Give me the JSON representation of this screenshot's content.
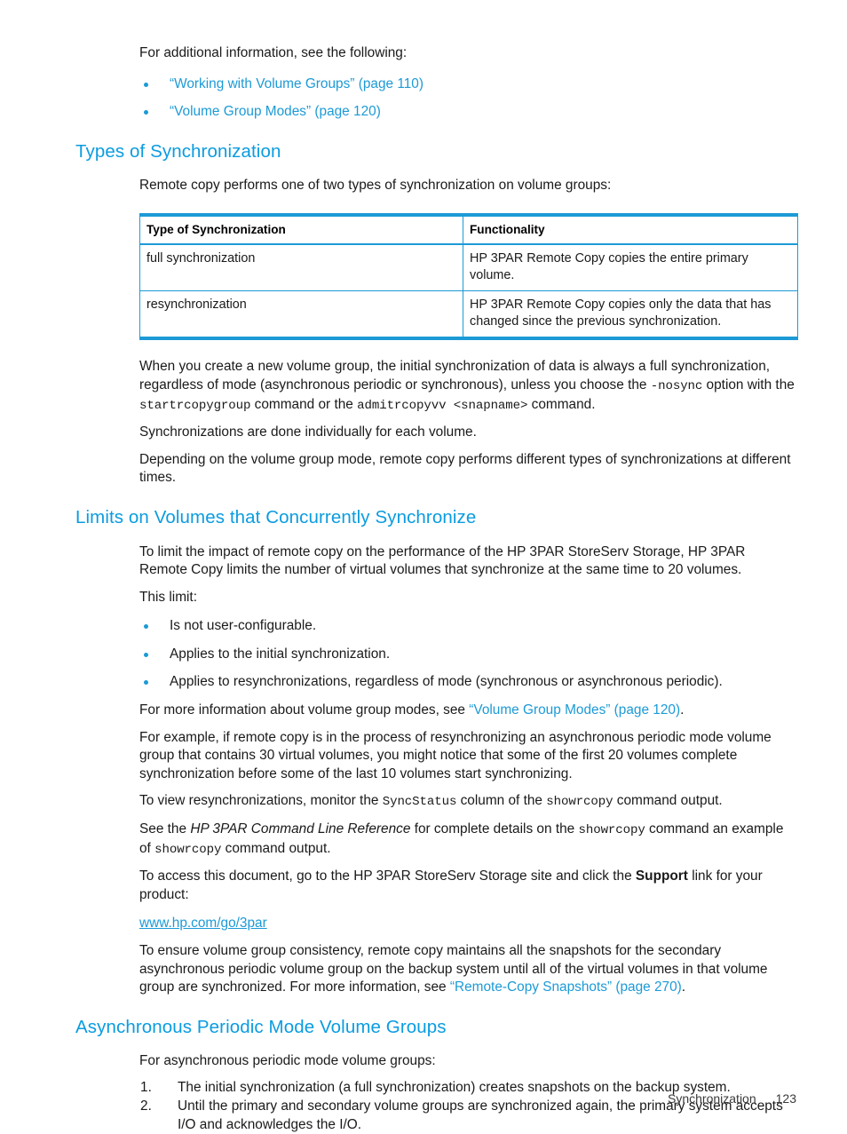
{
  "page": {
    "footer_section": "Synchronization",
    "footer_page_number": "123",
    "accent_color": "#1c9ad6",
    "heading_color": "#0a9ce0"
  },
  "intro": {
    "lead": "For additional information, see the following:",
    "links": [
      "“Working with Volume Groups” (page 110)",
      "“Volume Group Modes” (page 120)"
    ]
  },
  "types_section": {
    "heading": "Types of Synchronization",
    "intro": "Remote copy performs one of two types of synchronization on volume groups:",
    "table": {
      "headers": [
        "Type of Synchronization",
        "Functionality"
      ],
      "rows": [
        [
          "full synchronization",
          "HP 3PAR Remote Copy copies the entire primary volume."
        ],
        [
          "resynchronization",
          "HP 3PAR Remote Copy copies only the data that has changed since the previous synchronization."
        ]
      ]
    },
    "para_nosync_1": "When you create a new volume group, the initial synchronization of data is always a full synchronization, regardless of mode (asynchronous periodic or synchronous), unless you choose the ",
    "code_nosync": "-nosync",
    "para_nosync_2": " option with the ",
    "code_startrcopygroup": "startrcopygroup",
    "para_nosync_3": " command or the ",
    "code_admitrcopyvv": "admitrcopyvv <snapname>",
    "para_nosync_4": " command.",
    "para_individual": "Synchronizations are done individually for each volume.",
    "para_depending": "Depending on the volume group mode, remote copy performs different types of synchronizations at different times."
  },
  "limits_section": {
    "heading": "Limits on Volumes that Concurrently Synchronize",
    "para_limit": "To limit the impact of remote copy on the performance of the HP 3PAR StoreServ Storage, HP 3PAR Remote Copy limits the number of virtual volumes that synchronize at the same time to 20 volumes.",
    "this_limit_lead": "This limit:",
    "bullets": [
      "Is not user-configurable.",
      "Applies to the initial synchronization.",
      "Applies to resynchronizations, regardless of mode (synchronous or asynchronous periodic)."
    ],
    "para_moreinfo_1": "For more information about volume group modes, see ",
    "link_vgmodes": "“Volume Group Modes” (page 120)",
    "para_moreinfo_2": ".",
    "para_example": "For example, if remote copy is in the process of resynchronizing an asynchronous periodic mode volume group that contains 30 virtual volumes, you might notice that some of the first 20 volumes complete synchronization before some of the last 10 volumes start synchronizing.",
    "para_view_1": "To view resynchronizations, monitor the ",
    "code_syncstatus": "SyncStatus",
    "para_view_2": " column of the ",
    "code_showrcopy_1": "showrcopy",
    "para_view_3": " command output.",
    "para_see_1": "See the ",
    "italic_clireference": "HP 3PAR Command Line Reference",
    "para_see_2": " for complete details on the ",
    "code_showrcopy_2": "showrcopy",
    "para_see_3": " command an example of ",
    "code_showrcopy_3": "showrcopy",
    "para_see_4": " command output.",
    "para_access_1": "To access this document, go to the HP 3PAR StoreServ Storage site and click the ",
    "bold_support": "Support",
    "para_access_2": " link for your product:",
    "url": "www.hp.com/go/3par",
    "para_ensure_1": "To ensure volume group consistency, remote copy maintains all the snapshots for the secondary asynchronous periodic volume group on the backup system until all of the virtual volumes in that volume group are synchronized. For more information, see ",
    "link_rcsnapshots": "“Remote-Copy Snapshots” (page 270)",
    "para_ensure_2": "."
  },
  "async_section": {
    "heading": "Asynchronous Periodic Mode Volume Groups",
    "lead": "For asynchronous periodic mode volume groups:",
    "steps": [
      "The initial synchronization (a full synchronization) creates snapshots on the backup system.",
      "Until the primary and secondary volume groups are synchronized again, the primary system accepts I/O and acknowledges the I/O."
    ]
  }
}
